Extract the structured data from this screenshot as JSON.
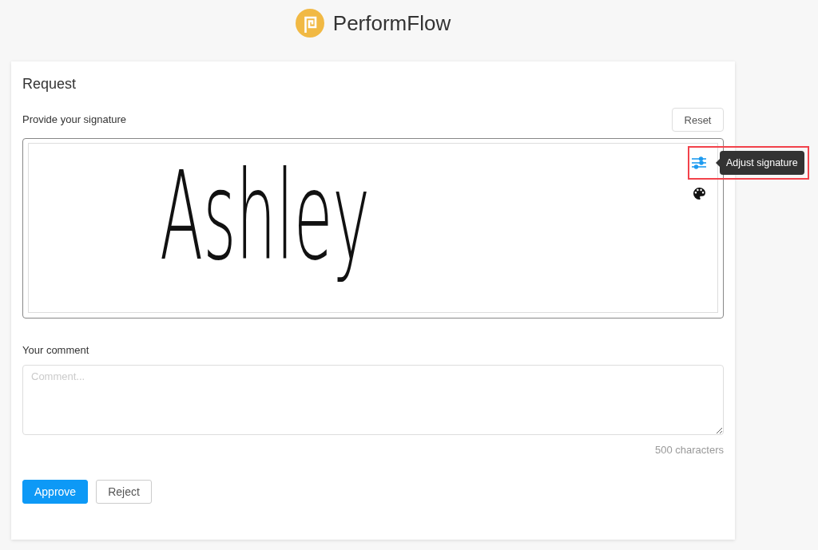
{
  "header": {
    "brand": "PerformFlow"
  },
  "request": {
    "title": "Request",
    "signature": {
      "label": "Provide your signature",
      "reset_button": "Reset",
      "value": "Ashley",
      "tools": [
        {
          "kind": "adjust",
          "tooltip": "Adjust signature",
          "highlighted": true
        },
        {
          "kind": "color",
          "highlighted": false
        }
      ]
    },
    "comment": {
      "label": "Your comment",
      "placeholder": "Comment...",
      "counter": "500 characters"
    },
    "buttons": [
      {
        "label": "Approve",
        "kind": "primary"
      },
      {
        "label": "Reject",
        "kind": "secondary"
      }
    ]
  }
}
